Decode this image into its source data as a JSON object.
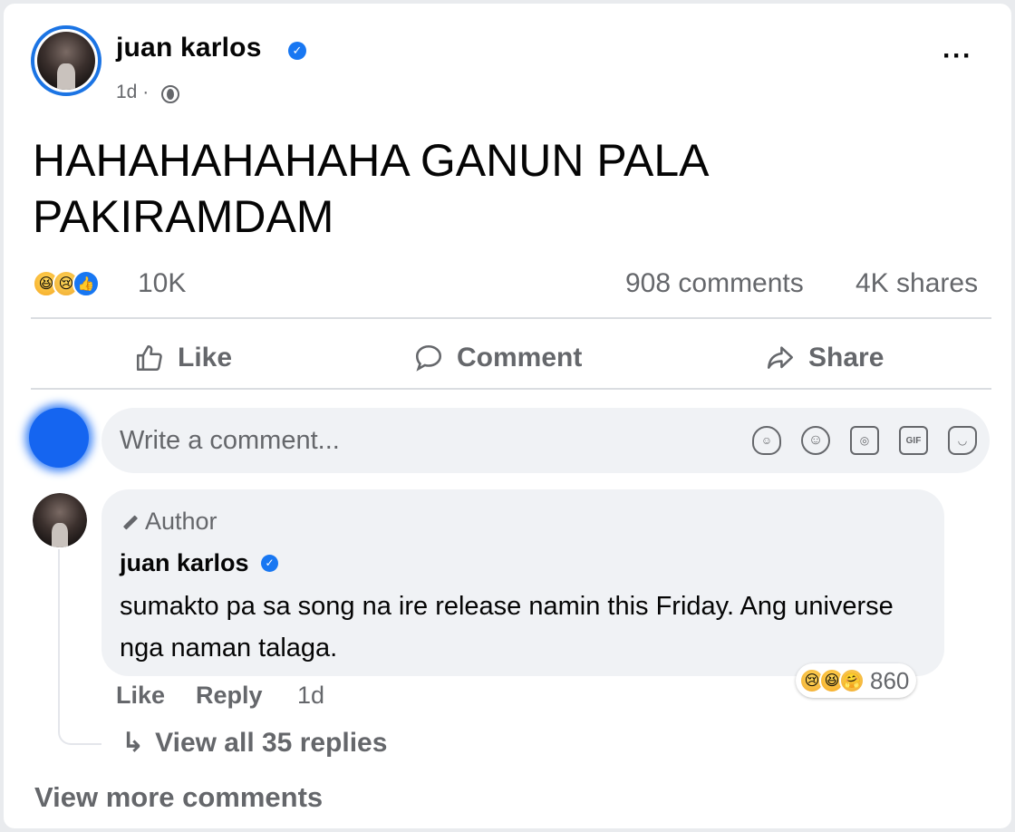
{
  "post": {
    "author": "juan karlos",
    "time": "1d",
    "time_separator": "·",
    "text": "HAHAHAHAHAHA GANUN PALA PAKIRAMDAM",
    "reaction_count": "10K",
    "reactions": [
      "haha",
      "sad",
      "like"
    ],
    "comments_count": "908 comments",
    "shares_count": "4K shares"
  },
  "actions": {
    "like": "Like",
    "comment": "Comment",
    "share": "Share"
  },
  "composer": {
    "placeholder": "Write a comment...",
    "tools": [
      "avatar-sticker-icon",
      "emoji-icon",
      "camera-icon",
      "gif-icon",
      "sticker-icon"
    ],
    "gif_label": "GIF"
  },
  "comment": {
    "badge": "Author",
    "author": "juan karlos",
    "text": "sumakto pa sa song na ire release namin this Friday. Ang universe nga naman talaga.",
    "reaction_count": "860",
    "reactions": [
      "sad",
      "haha",
      "care"
    ],
    "like_label": "Like",
    "reply_label": "Reply",
    "time": "1d",
    "view_replies": "View all 35 replies"
  },
  "footer": {
    "view_more": "View more comments"
  },
  "colors": {
    "accent": "#1877f2",
    "secondary_text": "#65676b",
    "bubble": "#f0f2f5"
  }
}
